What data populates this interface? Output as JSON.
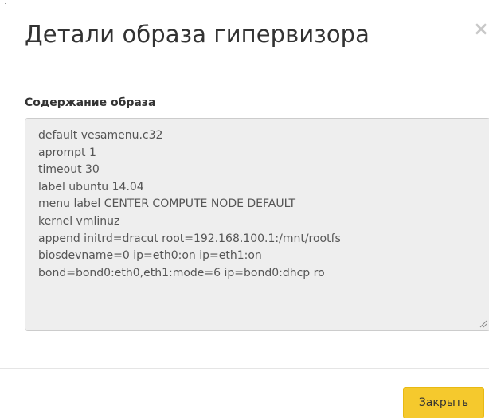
{
  "dialog": {
    "title": "Детали образа гипервизора",
    "close_icon": "×"
  },
  "content": {
    "label": "Содержание образа",
    "lines": [
      "default vesamenu.c32",
      "aprompt 1",
      "timeout 30",
      "label ubuntu 14.04",
      "menu label CENTER COMPUTE NODE DEFAULT",
      "kernel vmlinuz",
      "append initrd=dracut root=192.168.100.1:/mnt/rootfs",
      "biosdevname=0 ip=eth0:on ip=eth1:on",
      "bond=bond0:eth0,eth1:mode=6 ip=bond0:dhcp ro"
    ]
  },
  "footer": {
    "close_button_label": "Закрыть"
  },
  "colors": {
    "button_bg": "#f5c92d",
    "textarea_bg": "#eeeeee"
  }
}
